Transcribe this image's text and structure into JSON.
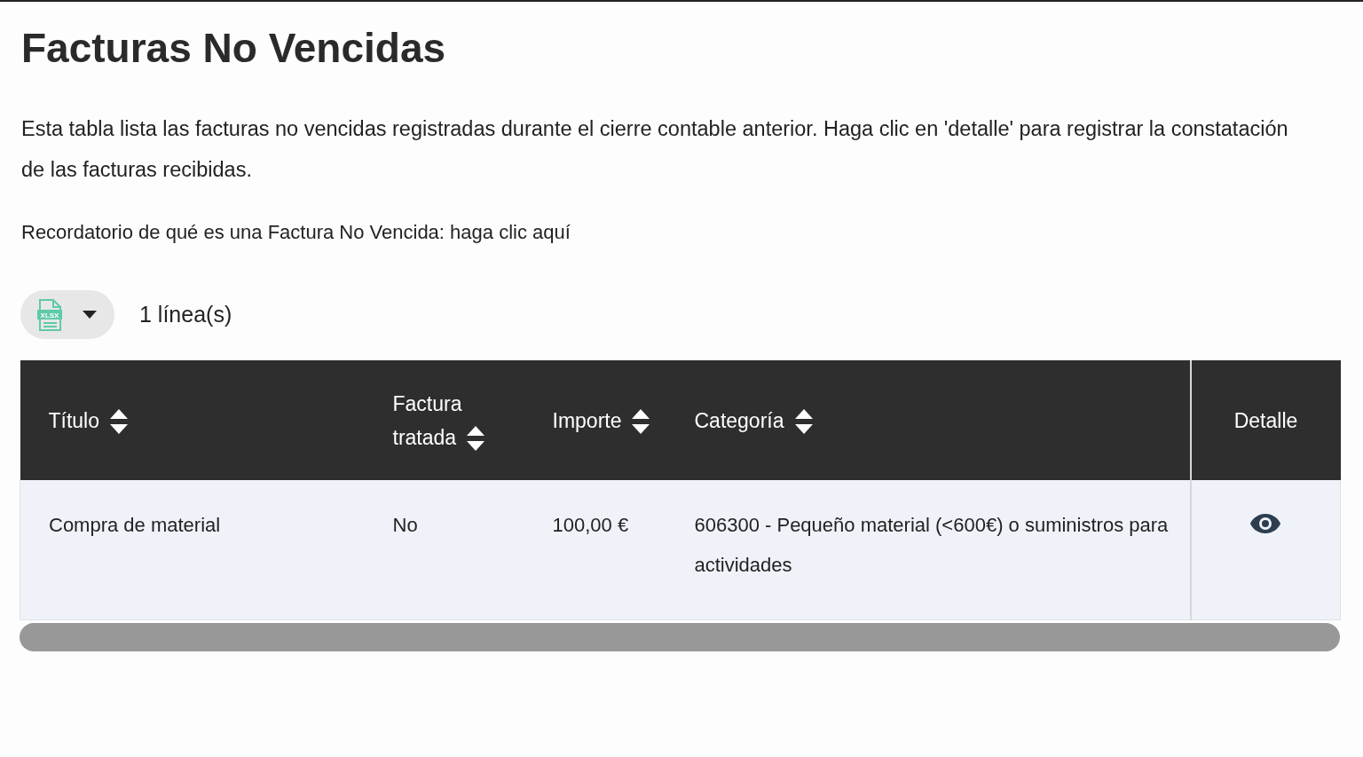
{
  "page": {
    "title": "Facturas No Vencidas",
    "description": "Esta tabla lista las facturas no vencidas registradas durante el cierre contable anterior. Haga clic en 'detalle' para registrar la constatación de las facturas recibidas.",
    "reminder": "Recordatorio de qué es una Factura No Vencida: haga clic aquí"
  },
  "toolbar": {
    "export_button": {
      "icon_label": "XLSX"
    },
    "row_count": "1 línea(s)"
  },
  "table": {
    "columns": [
      {
        "label": "Título",
        "sortable": true
      },
      {
        "label": "Factura tratada",
        "sortable": true
      },
      {
        "label": "Importe",
        "sortable": true
      },
      {
        "label": "Categoría",
        "sortable": true
      },
      {
        "label": "Detalle",
        "sortable": false
      }
    ],
    "rows": [
      {
        "cells": [
          "Compra de material",
          "No",
          "100,00 €",
          "606300 - Pequeño material (<600€) o suministros para actividades"
        ]
      }
    ]
  }
}
